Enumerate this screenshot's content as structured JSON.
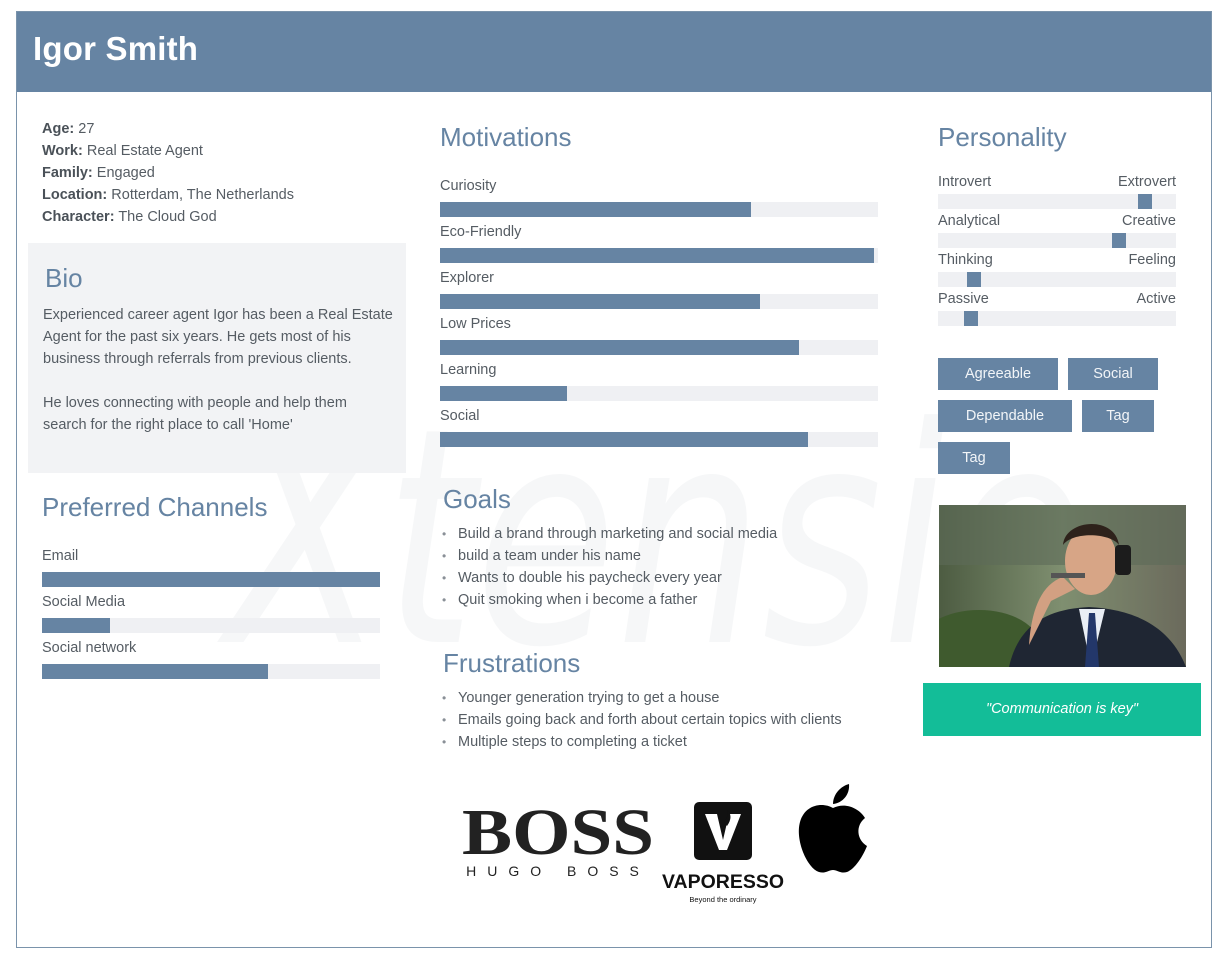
{
  "header": {
    "name": "Igor Smith"
  },
  "info": [
    {
      "label": "Age:",
      "value": "27"
    },
    {
      "label": "Work:",
      "value": "Real Estate Agent"
    },
    {
      "label": "Family:",
      "value": "Engaged"
    },
    {
      "label": "Location:",
      "value": "Rotterdam, The Netherlands"
    },
    {
      "label": "Character:",
      "value": "The Cloud God"
    }
  ],
  "bio": {
    "title": "Bio",
    "p1": "Experienced career agent Igor has been a Real Estate Agent for the past six years. He gets most of his business through referrals from previous clients.",
    "p2": "He loves connecting with people and help them search for the right place to call 'Home'"
  },
  "channels": {
    "title": "Preferred Channels",
    "items": [
      {
        "label": "Email",
        "level": 1.0
      },
      {
        "label": "Social Media",
        "level": 0.2
      },
      {
        "label": "Social network",
        "level": 0.67
      }
    ]
  },
  "motivations": {
    "title": "Motivations",
    "items": [
      {
        "label": "Curiosity",
        "level": 0.71
      },
      {
        "label": "Eco-Friendly",
        "level": 0.99
      },
      {
        "label": "Explorer",
        "level": 0.73
      },
      {
        "label": "Low Prices",
        "level": 0.82
      },
      {
        "label": "Learning",
        "level": 0.29
      },
      {
        "label": "Social",
        "level": 0.84
      }
    ]
  },
  "goals": {
    "title": "Goals",
    "items": [
      "Build a brand through marketing and social media",
      "build a team under his name",
      "Wants to double his paycheck every year",
      "Quit smoking when i become a father"
    ]
  },
  "frustrations": {
    "title": "Frustrations",
    "items": [
      "Younger generation trying to get a house",
      "Emails going back and forth about certain topics with clients",
      "Multiple steps to completing a ticket"
    ]
  },
  "personality": {
    "title": "Personality",
    "traits": [
      {
        "left": "Introvert",
        "right": "Extrovert",
        "position": 0.87
      },
      {
        "left": "Analytical",
        "right": "Creative",
        "position": 0.76
      },
      {
        "left": "Thinking",
        "right": "Feeling",
        "position": 0.15
      },
      {
        "left": "Passive",
        "right": "Active",
        "position": 0.14
      }
    ]
  },
  "tags": [
    "Agreeable",
    "Social",
    "Dependable",
    "Tag",
    "Tag"
  ],
  "quote": "\"Communication is key\"",
  "brands": {
    "boss_big": "BOSS",
    "boss_small": "HUGO BOSS",
    "vaporesso": "VAPORESSO",
    "vaporesso_tagline": "Beyond the ordinary",
    "apple": "apple-logo"
  },
  "watermark": {
    "text": "Xtensio"
  },
  "colors": {
    "accent": "#6684a3",
    "quote_bg": "#13bd98",
    "track": "#eff0f3",
    "bio_bg": "#f2f3f5"
  }
}
